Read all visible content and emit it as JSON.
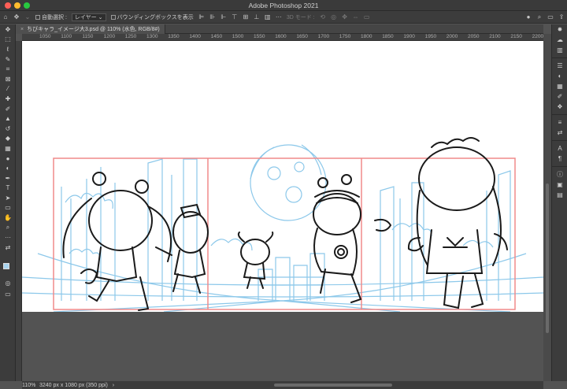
{
  "window": {
    "title": "Adobe Photoshop 2021"
  },
  "options_bar": {
    "auto_select_label": "自動選択 :",
    "auto_select_target": "レイヤー",
    "bounding_box_label": "バウンディングボックスを表示",
    "mode_3d_label": "3D モード :"
  },
  "document": {
    "tab_title": "ちびキャラ_イメージ大3.psd @ 110% (水色, RGB/8#)",
    "tab_close": "×"
  },
  "ruler": {
    "h_ticks": [
      "1050",
      "1100",
      "1150",
      "1200",
      "1250",
      "1300",
      "1350",
      "1400",
      "1450",
      "1500",
      "1550",
      "1600",
      "1650",
      "1700",
      "1750",
      "1800",
      "1850",
      "1900",
      "1950",
      "2000",
      "2050",
      "2100",
      "2150",
      "2200"
    ]
  },
  "status": {
    "zoom": "110%",
    "doc_info": "3240 px x 1080 px (350 ppi)",
    "arrow": "›"
  },
  "colors": {
    "foreground": "#a8d4ef",
    "background": "#ffffff",
    "guide_red": "#f08a8a",
    "sketch_blue": "#8cc8ea"
  },
  "tools_left": [
    "move-icon",
    "marquee-icon",
    "lasso-icon",
    "quick-select-icon",
    "crop-icon",
    "frame-icon",
    "eyedropper-icon",
    "healing-icon",
    "brush-icon",
    "stamp-icon",
    "history-brush-icon",
    "eraser-icon",
    "gradient-icon",
    "blur-icon",
    "dodge-icon",
    "pen-icon",
    "type-icon",
    "path-select-icon",
    "shape-icon",
    "hand-icon",
    "zoom-icon",
    "more-icon"
  ],
  "tools_right": [
    "adjust-icon",
    "swatches-icon",
    "libraries-icon",
    "color-icon",
    "properties-icon",
    "brushes-icon",
    "layers-icon",
    "channels-icon",
    "paths-icon",
    "character-icon",
    "paragraph-icon",
    "info-icon",
    "navigator-icon",
    "histogram-icon"
  ]
}
